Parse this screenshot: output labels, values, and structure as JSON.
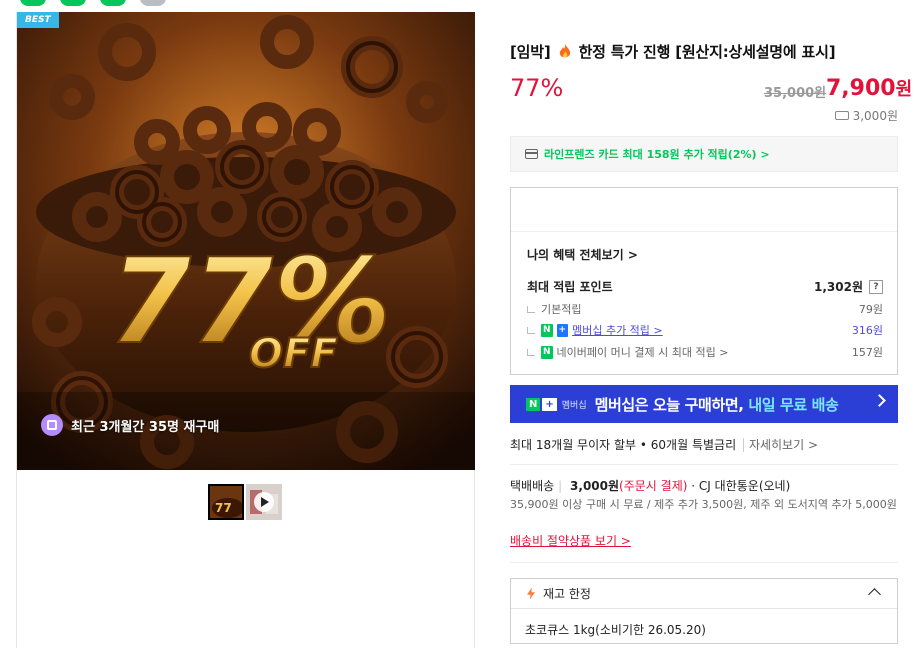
{
  "product": {
    "badge": "BEST",
    "repurchase_text": "최근 3개월간 35명 재구매",
    "image_overlay_percent": "77%",
    "image_overlay_off": "OFF",
    "title_prefix": "[임박]",
    "title_main": "한정 특가 진행 [원산지:상세설명에 표시]",
    "discount_rate": "77%",
    "original_price": "35,000원",
    "sale_price": "7,900",
    "sale_currency": "원",
    "shipping_fee": "3,000원"
  },
  "card_promo": {
    "text": "라인프렌즈 카드 최대 158원 추가 적립(2%) >"
  },
  "benefits": {
    "view_all": "나의 혜택 전체보기 >",
    "max_points_label": "최대 적립 포인트",
    "max_points_value": "1,302원",
    "help": "?",
    "base_label": "기본적립",
    "base_value": "79원",
    "membership_label": "멤버십 추가 적립 >",
    "membership_value": "316원",
    "npay_label": "네이버페이 머니 결제 시 최대 적립 >",
    "npay_value": "157원",
    "badge_n": "N",
    "badge_plus": "+"
  },
  "membership_banner": {
    "logo_n": "N",
    "logo_plus": "+",
    "logo_label": "멤버십",
    "text_main": "멤버십은 오늘 구매하면, ",
    "text_highlight": "내일 무료 배송"
  },
  "installment": {
    "text": "최대 18개월 무이자 할부 • 60개월 특별금리",
    "detail": "자세히보기 >"
  },
  "delivery": {
    "type": "택배배송",
    "fee": "3,000원",
    "prepay": "(주문시 결제)",
    "dot": "·",
    "carrier": "CJ 대한통운(오네)",
    "note": "35,900원 이상 구매 시 무료 / 제주 추가 3,500원, 제주 외 도서지역 추가 5,000원",
    "saving_link": "배송비 절약상품 보기 >"
  },
  "stock": {
    "label": "재고 한정",
    "option": "초코큐스 1kg(소비기한 26.05.20)"
  },
  "colors": {
    "accent_red": "#e2133a",
    "naver_green": "#03c75a",
    "membership_blue": "#2b3fd6",
    "membership_purple": "#4d4ad8"
  }
}
